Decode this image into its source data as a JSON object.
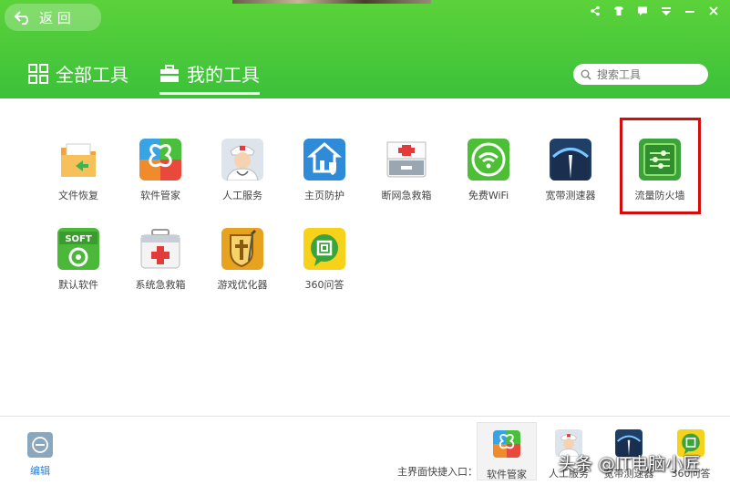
{
  "header": {
    "back_label": "返 回",
    "tabs": [
      {
        "label": "全部工具"
      },
      {
        "label": "我的工具"
      }
    ],
    "search_placeholder": "搜索工具"
  },
  "tools": [
    {
      "label": "文件恢复",
      "icon": "file-recovery-icon"
    },
    {
      "label": "软件管家",
      "icon": "software-manager-icon"
    },
    {
      "label": "人工服务",
      "icon": "manual-service-icon"
    },
    {
      "label": "主页防护",
      "icon": "homepage-protection-icon"
    },
    {
      "label": "断网急救箱",
      "icon": "network-first-aid-icon"
    },
    {
      "label": "免费WiFi",
      "icon": "free-wifi-icon"
    },
    {
      "label": "宽带测速器",
      "icon": "broadband-speed-test-icon"
    },
    {
      "label": "流量防火墙",
      "icon": "traffic-firewall-icon"
    },
    {
      "label": "默认软件",
      "icon": "default-software-icon"
    },
    {
      "label": "系统急救箱",
      "icon": "system-first-aid-icon"
    },
    {
      "label": "游戏优化器",
      "icon": "game-optimizer-icon"
    },
    {
      "label": "360问答",
      "icon": "qa-360-icon"
    }
  ],
  "footer": {
    "edit_label": "编辑",
    "quick_entry_label": "主界面快捷入口：",
    "quick_items": [
      {
        "label": "软件管家"
      },
      {
        "label": "人工服务"
      },
      {
        "label": "宽带测速器"
      },
      {
        "label": "360问答"
      }
    ]
  },
  "watermark": "头条 @IT电脑小匠",
  "colors": {
    "header_green": "#3cc13a",
    "highlight_red": "#d40c0c",
    "edit_blue": "#2a7fd0"
  }
}
